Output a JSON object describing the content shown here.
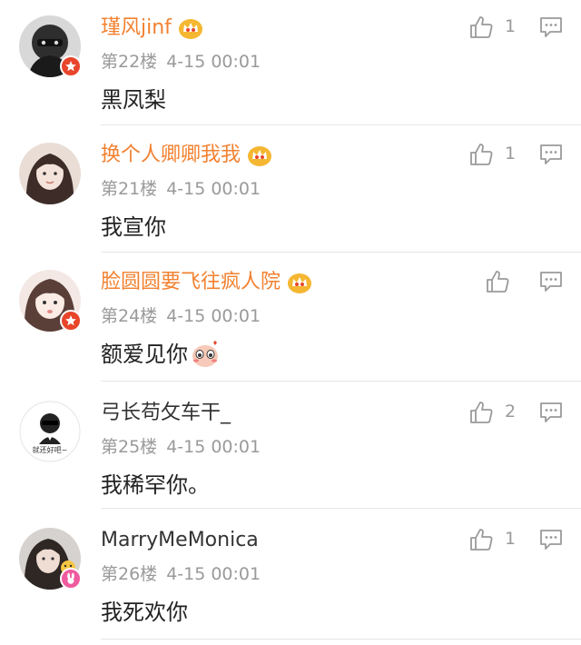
{
  "comments": [
    {
      "username": "瑾风jinf",
      "vip": true,
      "floor": "第22楼",
      "time": "4-15 00:01",
      "content": "黑凤梨",
      "likes": "1",
      "avatar_badge": "verified-star-icon",
      "avatar_colors": [
        "#3c3c3c",
        "#1f1f1f"
      ]
    },
    {
      "username": "换个人卿卿我我",
      "vip": true,
      "floor": "第21楼",
      "time": "4-15 00:01",
      "content": "我宣你",
      "likes": "1",
      "avatar_badge": "",
      "avatar_colors": [
        "#e8d8d2",
        "#4a3632"
      ]
    },
    {
      "username": "脸圆圆要飞往疯人院",
      "vip": true,
      "floor": "第24楼",
      "time": "4-15 00:01",
      "content": "额爱见你",
      "likes": "",
      "avatar_badge": "verified-star-icon",
      "avatar_colors": [
        "#f1e2dc",
        "#6b4f48"
      ],
      "sticker": "blushing-emoji-sticker"
    },
    {
      "username": "弓长苟攵车干_",
      "vip": false,
      "floor": "第25楼",
      "time": "4-15 00:01",
      "content": "我稀罕你。",
      "likes": "2",
      "avatar_badge": "",
      "avatar_colors": [
        "#ffffff",
        "#222222"
      ],
      "avatar_caption": "就还好吧~"
    },
    {
      "username": "MarryMeMonica",
      "vip": false,
      "floor": "第26楼",
      "time": "4-15 00:01",
      "content": "我死欢你",
      "likes": "1",
      "avatar_badge": "rabbit-badge-icon",
      "avatar_colors": [
        "#c9c6c4",
        "#2a2624"
      ]
    }
  ],
  "colors": {
    "vip_name": "#f28130",
    "plain_name": "#333333",
    "meta": "#9a9a9a",
    "content": "#222222",
    "icon": "#9a9a9a",
    "badge_red": "#e8452b",
    "badge_pink": "#f05a9e",
    "crown": "#f5b731"
  }
}
